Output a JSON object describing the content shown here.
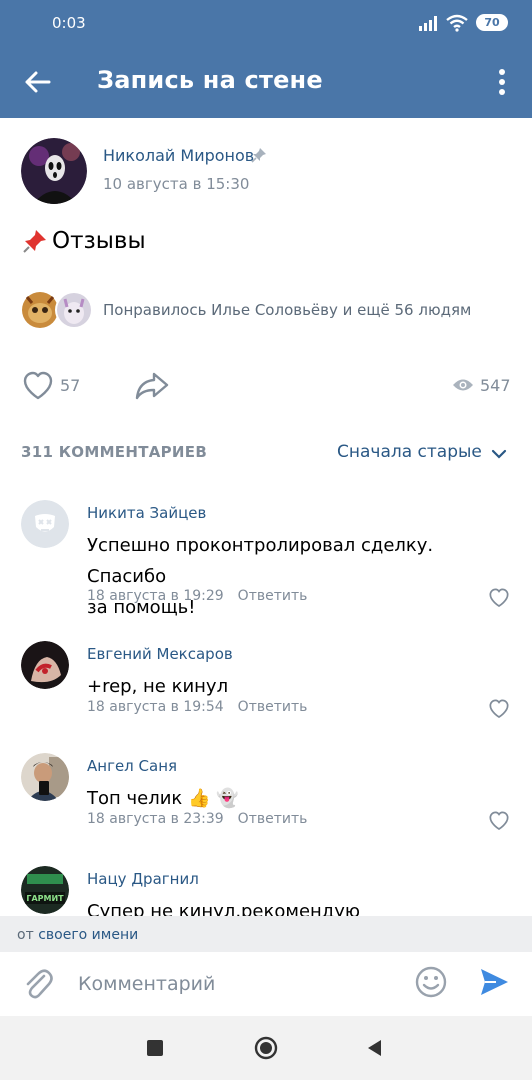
{
  "status_bar": {
    "time": "0:03",
    "battery": "70"
  },
  "header": {
    "title": "Запись на стене"
  },
  "post": {
    "author": "Николай Миронов",
    "date": "10 августа в 15:30",
    "text": "Отзывы",
    "liked_by": "Понравилось Илье Соловьёву и ещё 56 людям",
    "likes": "57",
    "views": "547"
  },
  "comments_section": {
    "count_label": "311 КОММЕНТАРИЕВ",
    "sort_label": "Сначала старые"
  },
  "comments": [
    {
      "author": "Никита Зайцев",
      "lines": [
        "Успешно проконтролировал сделку. Спасибо",
        "за помощь!"
      ],
      "date": "18 августа в 19:29",
      "reply": "Ответить"
    },
    {
      "author": "Евгений Мексаров",
      "lines": [
        "+rep, не кинул"
      ],
      "date": "18 августа в 19:54",
      "reply": "Ответить"
    },
    {
      "author": "Ангел Саня",
      "lines": [
        "Топ челик 👍 👻"
      ],
      "date": "18 августа в 23:39",
      "reply": "Ответить"
    },
    {
      "author": "Нацу Драгнил",
      "lines": [
        "Супер не кинул,рекомендую"
      ],
      "avatar_text": "ГАРМИТ"
    }
  ],
  "compose": {
    "from_prefix": "от",
    "from_link": "своего имени",
    "placeholder": "Комментарий"
  },
  "colors": {
    "brand": "#4a76a8",
    "link": "#2a5885",
    "secondary": "#818c99",
    "send": "#3f8ae0"
  }
}
